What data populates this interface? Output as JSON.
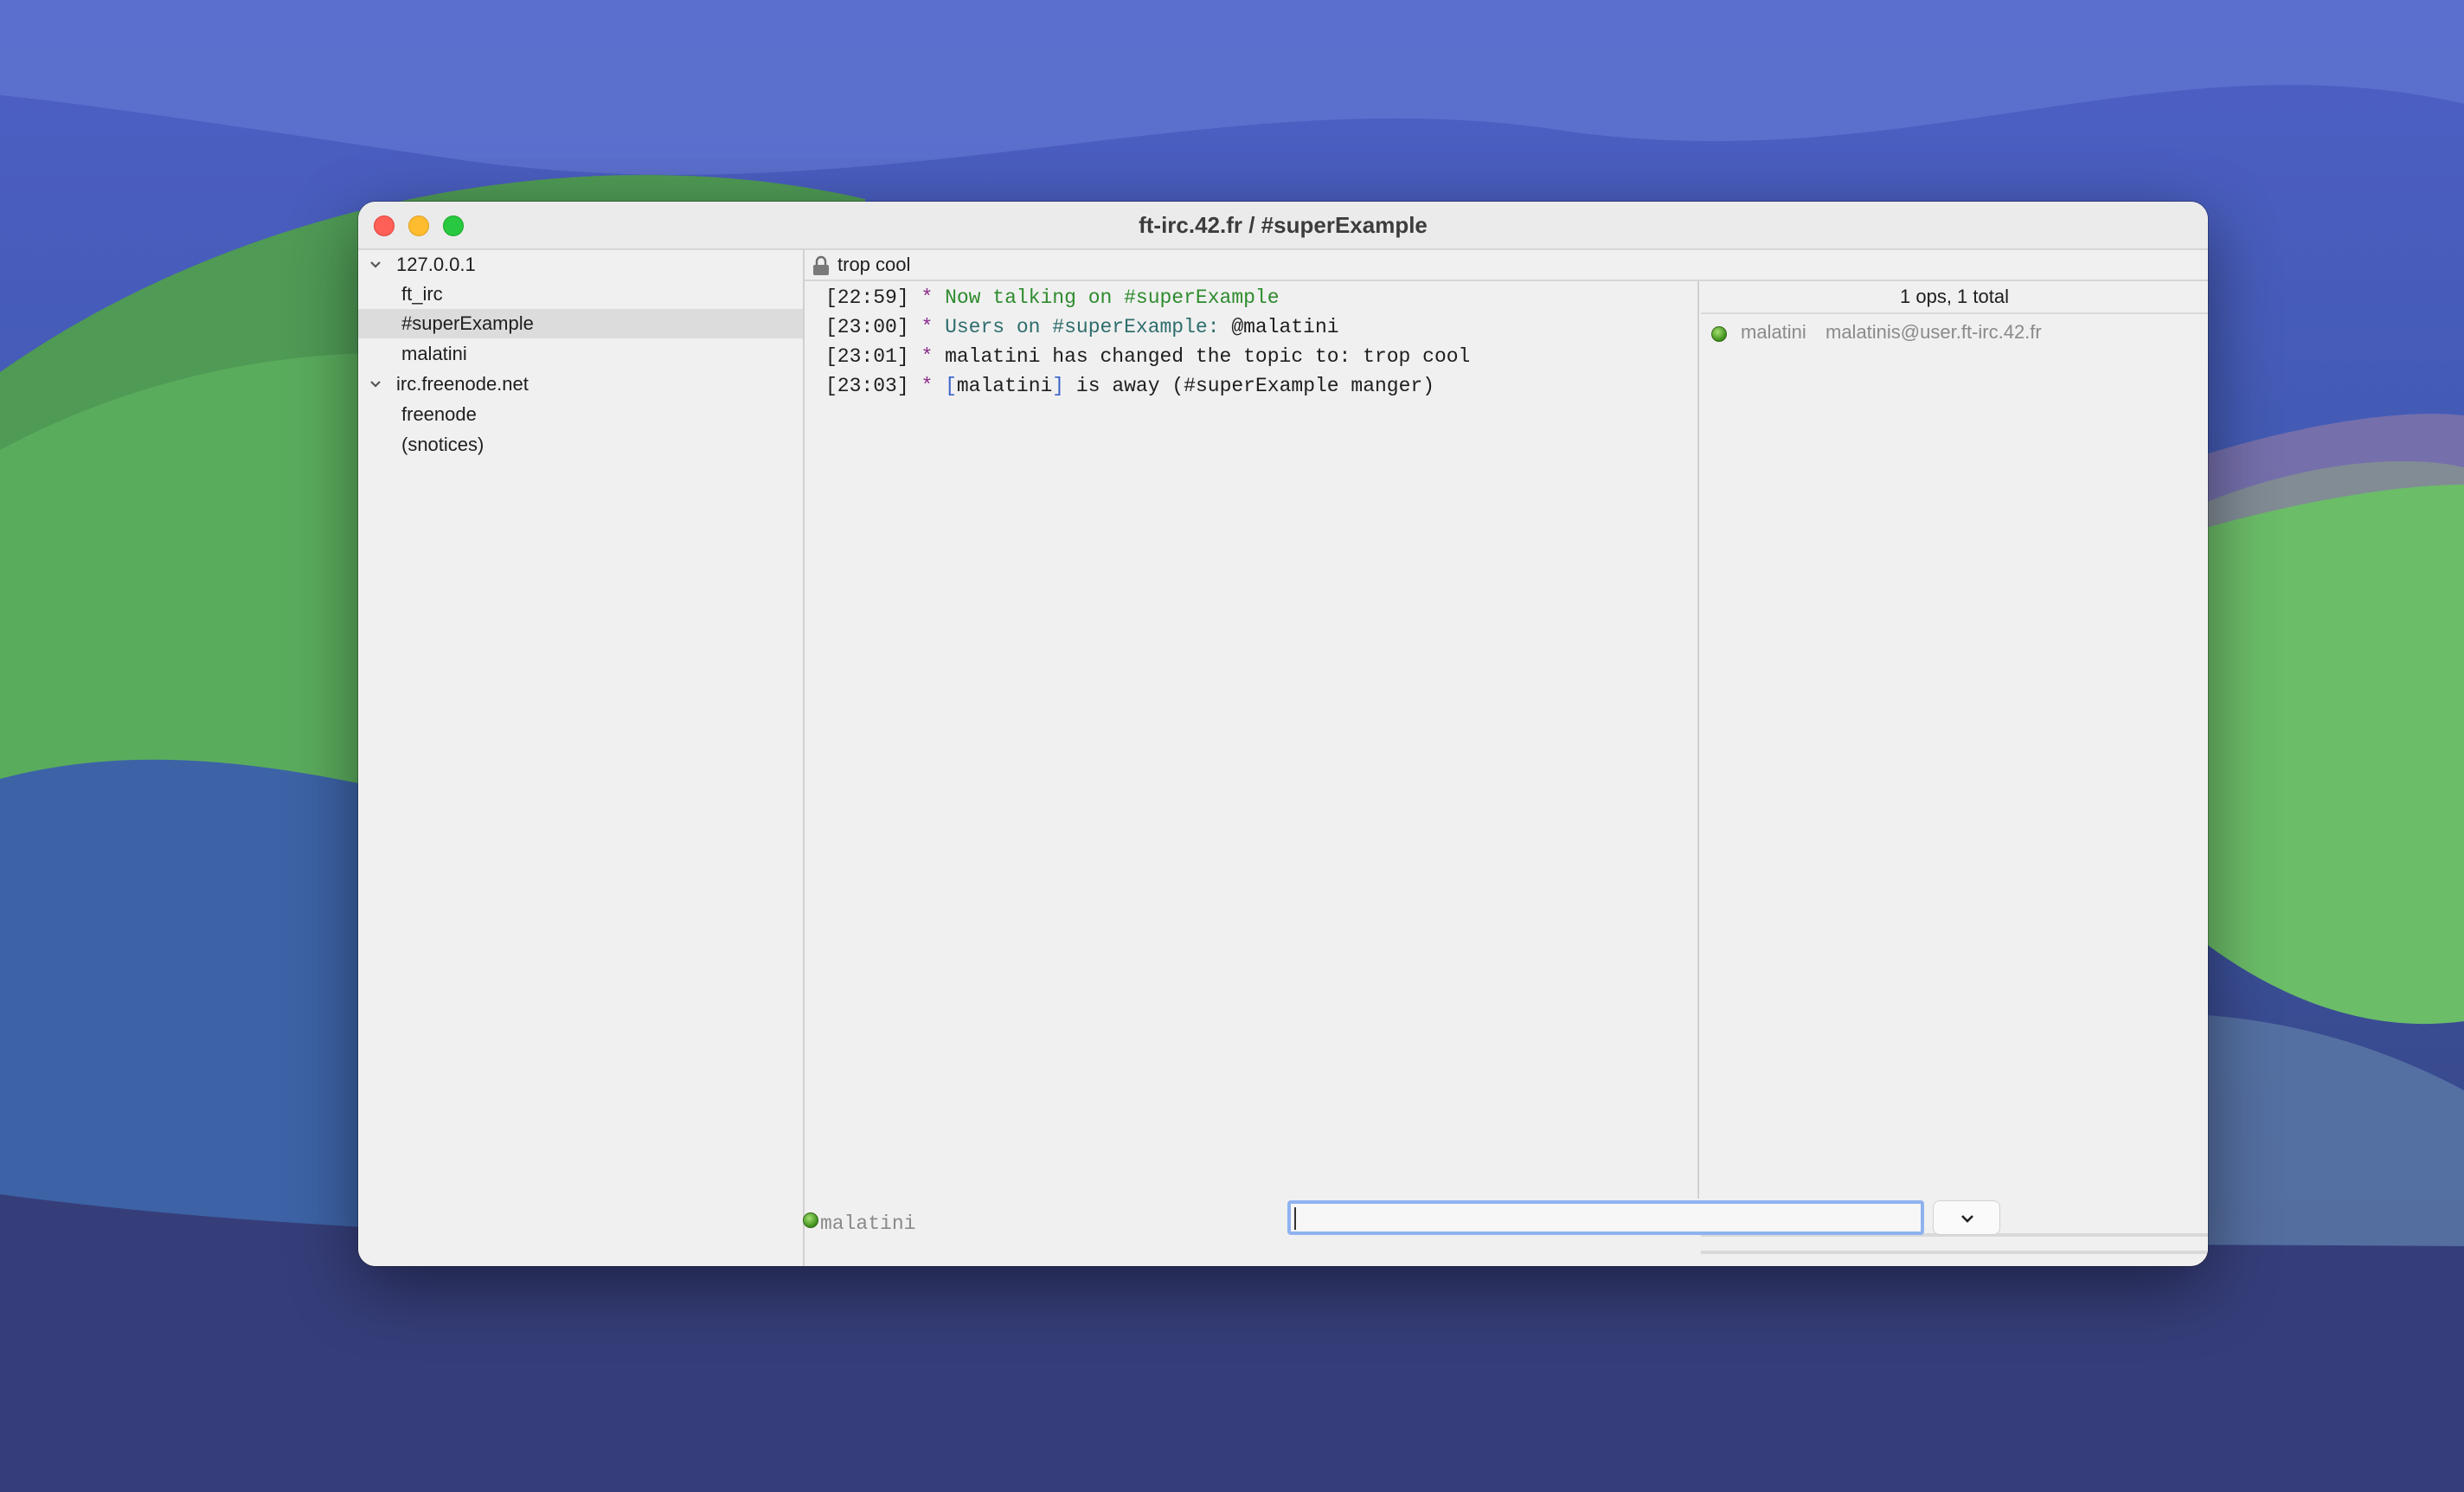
{
  "window": {
    "title": "ft-irc.42.fr / #superExample"
  },
  "sidebar": {
    "items": [
      {
        "label": "127.0.0.1",
        "type": "server",
        "expanded": true
      },
      {
        "label": "ft_irc",
        "type": "channel"
      },
      {
        "label": "#superExample",
        "type": "channel",
        "selected": true
      },
      {
        "label": "malatini",
        "type": "query"
      },
      {
        "label": "irc.freenode.net",
        "type": "server",
        "expanded": true
      },
      {
        "label": "freenode",
        "type": "channel"
      },
      {
        "label": "(snotices)",
        "type": "channel"
      }
    ]
  },
  "topic": {
    "icon": "lock-icon",
    "text": "trop cool"
  },
  "chat": {
    "messages": [
      {
        "ts": "[22:59]",
        "star": "*",
        "text": "Now talking on #superExample"
      },
      {
        "ts": "[23:00]",
        "star": "*",
        "text": "Users on #superExample:",
        "nick": "@malatini"
      },
      {
        "ts": "[23:01]",
        "star": "*",
        "text": "malatini has changed the topic to: trop cool"
      },
      {
        "ts": "[23:03]",
        "star": "*",
        "lbr": "[",
        "nick": "malatini",
        "rbr": "]",
        "mid": "is away",
        "lp": "(",
        "reason": "#superExample manger",
        "rp": ")"
      }
    ]
  },
  "userlist": {
    "summary": "1 ops, 1 total",
    "users": [
      {
        "nick": "malatini",
        "host": "malatinis@user.ft-irc.42.fr",
        "status": "online"
      }
    ]
  },
  "inputbar": {
    "nick": "malatini",
    "value": ""
  },
  "colors": {
    "accent": "#8fb2f0",
    "chat_green": "#2e8b2e",
    "chat_teal": "#2f6d6d",
    "chat_star": "#8a2a8a",
    "chat_bracket": "#3a62c9"
  }
}
